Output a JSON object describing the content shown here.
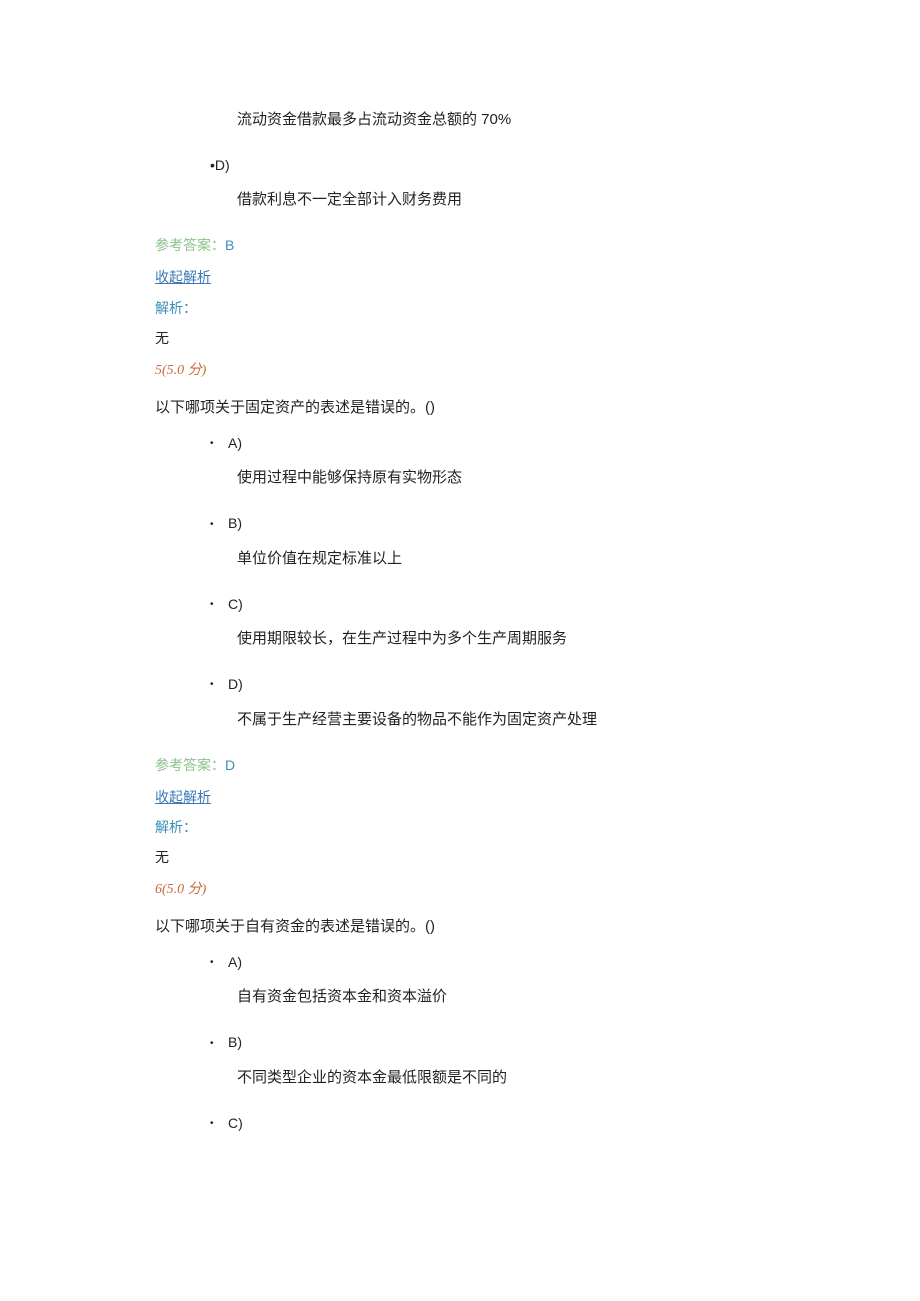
{
  "q4_partial": {
    "opt_c_text": "流动资金借款最多占流动资金总额的 70%",
    "opt_d_bullet": "•D)",
    "opt_d_text": "借款利息不一定全部计入财务费用",
    "answer_label": "参考答案：",
    "answer_value": "B",
    "collapse": "收起解析",
    "analysis_label": "解析：",
    "analysis_value": "无"
  },
  "q5": {
    "number": "5(5.0 分)",
    "text": "以下哪项关于固定资产的表述是错误的。()",
    "opt_a_bullet": "A)",
    "opt_a_text": "使用过程中能够保持原有实物形态",
    "opt_b_bullet": "B)",
    "opt_b_text": "单位价值在规定标准以上",
    "opt_c_bullet": "C)",
    "opt_c_text": "使用期限较长，在生产过程中为多个生产周期服务",
    "opt_d_bullet": "D)",
    "opt_d_text": "不属于生产经营主要设备的物品不能作为固定资产处理",
    "answer_label": "参考答案：",
    "answer_value": "D",
    "collapse": "收起解析",
    "analysis_label": "解析：",
    "analysis_value": "无"
  },
  "q6": {
    "number": "6(5.0 分)",
    "text": "以下哪项关于自有资金的表述是错误的。()",
    "opt_a_bullet": "A)",
    "opt_a_text": "自有资金包括资本金和资本溢价",
    "opt_b_bullet": "B)",
    "opt_b_text": "不同类型企业的资本金最低限额是不同的",
    "opt_c_bullet": "C)"
  }
}
